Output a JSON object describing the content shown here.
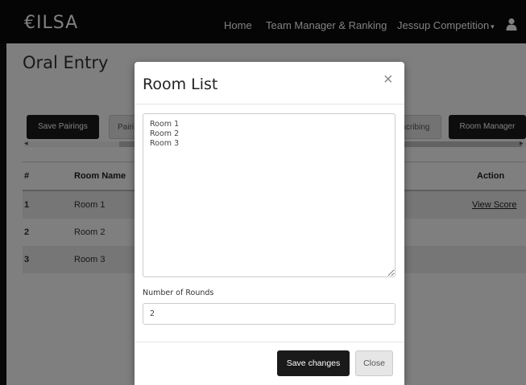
{
  "navbar": {
    "brand": "€ILSA",
    "links": {
      "home": "Home",
      "team": "Team Manager & Ranking",
      "competition": "Jessup Competition"
    },
    "competition_caret": "▾",
    "user_icon": "user-icon"
  },
  "page": {
    "title": "Oral Entry",
    "buttons": {
      "save_pairings": "Save Pairings",
      "pair_partial": "Pairi",
      "describing_partial": "scribing",
      "room_manager": "Room Manager"
    },
    "table": {
      "headers": {
        "num": "#",
        "room": "Room Name",
        "action": "Action"
      },
      "rows": [
        {
          "num": "1",
          "room": "Room 1",
          "action": "View Score"
        },
        {
          "num": "2",
          "room": "Room 2",
          "action": ""
        },
        {
          "num": "3",
          "room": "Room 3",
          "action": ""
        }
      ]
    }
  },
  "modal": {
    "title": "Room List",
    "close_glyph": "×",
    "room_list_value": "Room 1\nRoom 2\nRoom 3",
    "rounds_label": "Number of Rounds",
    "rounds_value": "2",
    "save_label": "Save changes",
    "close_label": "Close"
  },
  "colors": {
    "navbar_bg": "#0a0a0a",
    "dark_button": "#1a1a1a",
    "light_button": "#e6e6e6",
    "row_stripe": "#ececec"
  }
}
